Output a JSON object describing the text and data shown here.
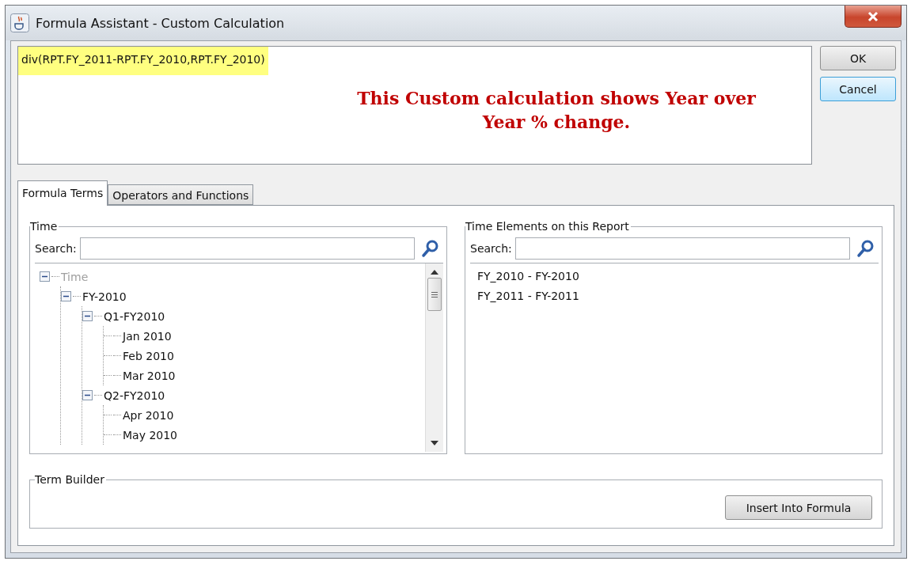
{
  "window": {
    "title": "Formula Assistant - Custom Calculation"
  },
  "formula": {
    "text": "div(RPT.FY_2011-RPT.FY_2010,RPT.FY_2010)",
    "selected": true
  },
  "annotation": "This Custom calculation shows Year over Year % change.",
  "buttons": [
    {
      "label": "OK",
      "focused": false
    },
    {
      "label": "Cancel",
      "focused": true
    }
  ],
  "tabs": [
    {
      "label": "Formula Terms",
      "selected": true
    },
    {
      "label": "Operators and Functions",
      "selected": false
    }
  ],
  "time_panel": {
    "title": "Time",
    "search_label": "Search:",
    "tree": [
      {
        "label": "Time",
        "disabled": true,
        "expanded": true,
        "children": [
          {
            "label": "FY-2010",
            "disabled": false,
            "expanded": true,
            "children": [
              {
                "label": "Q1-FY2010",
                "disabled": false,
                "expanded": true,
                "children": [
                  {
                    "label": "Jan 2010",
                    "disabled": false
                  },
                  {
                    "label": "Feb 2010",
                    "disabled": false
                  },
                  {
                    "label": "Mar 2010",
                    "disabled": false
                  }
                ]
              },
              {
                "label": "Q2-FY2010",
                "disabled": false,
                "expanded": true,
                "children": [
                  {
                    "label": "Apr 2010",
                    "disabled": false
                  },
                  {
                    "label": "May 2010",
                    "disabled": false
                  }
                ]
              }
            ]
          }
        ]
      }
    ]
  },
  "report_panel": {
    "title": "Time Elements on this Report",
    "search_label": "Search:",
    "items": [
      "FY_2010 - FY-2010",
      "FY_2011 - FY-2011"
    ]
  },
  "term_builder": {
    "title": "Term Builder",
    "button": "Insert Into Formula"
  }
}
